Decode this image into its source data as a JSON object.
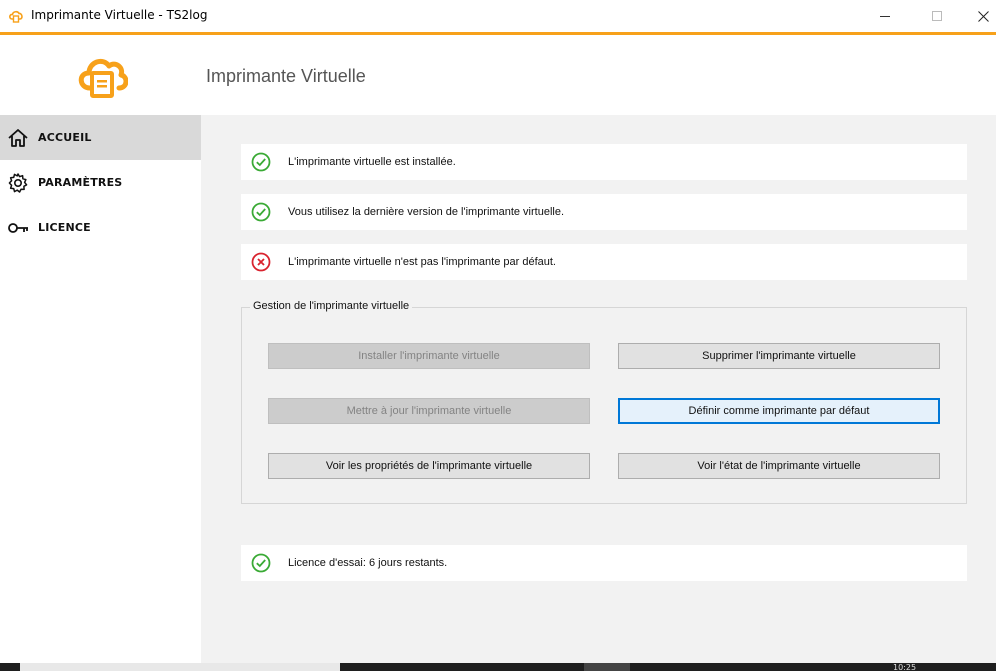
{
  "window": {
    "title": "Imprimante Virtuelle - TS2log",
    "accent_color": "#f7a11a"
  },
  "header": {
    "logo_icon": "cloud-printer-icon",
    "title": "Imprimante Virtuelle"
  },
  "sidebar": {
    "items": [
      {
        "label": "ACCUEIL",
        "icon": "home-icon",
        "active": true
      },
      {
        "label": "PARAMÈTRES",
        "icon": "gear-icon",
        "active": false
      },
      {
        "label": "LICENCE",
        "icon": "key-icon",
        "active": false
      }
    ]
  },
  "status": [
    {
      "text": "L'imprimante virtuelle est installée.",
      "state": "ok"
    },
    {
      "text": "Vous utilisez la dernière version de l'imprimante virtuelle.",
      "state": "ok"
    },
    {
      "text": "L'imprimante virtuelle n'est pas l'imprimante par défaut.",
      "state": "error"
    }
  ],
  "management": {
    "title": "Gestion de l'imprimante virtuelle",
    "buttons": {
      "install": "Installer l'imprimante virtuelle",
      "delete": "Supprimer l'imprimante virtuelle",
      "update": "Mettre à jour l'imprimante virtuelle",
      "set_default": "Définir comme imprimante par défaut",
      "properties": "Voir les propriétés de l'imprimante virtuelle",
      "state": "Voir l'état de l'imprimante virtuelle"
    }
  },
  "license": {
    "text": "Licence d'essai: 6 jours restants.",
    "state": "ok"
  },
  "taskbar": {
    "clock": "10:25"
  },
  "colors": {
    "ok": "#3aaa35",
    "error": "#d9232e",
    "focus": "#0078d7"
  }
}
